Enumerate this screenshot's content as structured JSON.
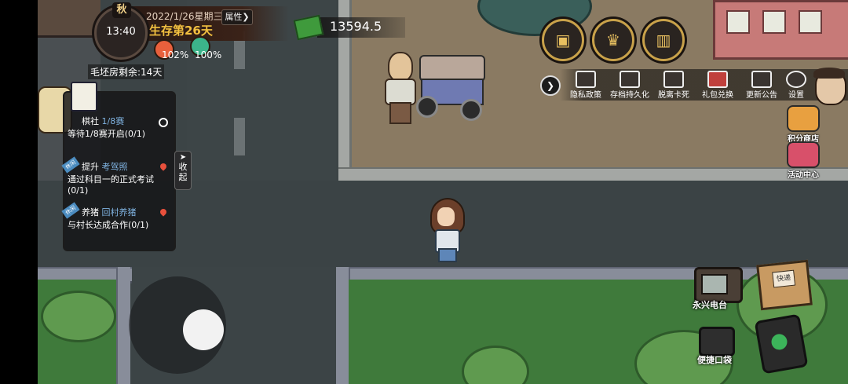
{
  "hud": {
    "season": "秋",
    "clock_time": "13:40",
    "date": "2022/1/26星期三",
    "survival_days": "生存第26天",
    "attributes_button": "属性",
    "attributes_arrow": "❯",
    "satiety": "102%",
    "cleanliness": "100%",
    "rent_remaining": "毛坯房剩余:14天"
  },
  "money": {
    "amount": "13594.5"
  },
  "quests": {
    "collapse_label": "收起",
    "items": [
      {
        "tag": "",
        "title_prefix": "棋社",
        "title_highlight": "1/8赛",
        "desc": "等待1/8赛开启(0/1)"
      },
      {
        "tag": "休闲",
        "title_prefix": "提升",
        "title_highlight": "考驾照",
        "desc": "通过科目一的正式考试(0/1)"
      },
      {
        "tag": "休闲",
        "title_prefix": "养猪",
        "title_highlight": "回村养猪",
        "desc": "与村长达成合作(0/1)"
      }
    ]
  },
  "menu": {
    "expand_arrow": "❯",
    "items": [
      {
        "label": "隐私政策",
        "icon": "document-icon"
      },
      {
        "label": "存档持久化",
        "icon": "save-icon"
      },
      {
        "label": "脱离卡死",
        "icon": "unstuck-icon"
      },
      {
        "label": "礼包兑换",
        "icon": "gift-icon"
      },
      {
        "label": "更新公告",
        "icon": "announcement-icon"
      },
      {
        "label": "设置",
        "icon": "gear-icon"
      }
    ]
  },
  "side_buttons": {
    "shop": "积分商店",
    "events": "活动中心"
  },
  "bottom_right": {
    "radio": "永兴电台",
    "box_tape": "快递",
    "pocket": "便捷口袋"
  },
  "colors": {
    "accent_gold": "#c9a24a",
    "survival_text": "#f2c040",
    "quest_highlight": "#7fb2e0"
  }
}
